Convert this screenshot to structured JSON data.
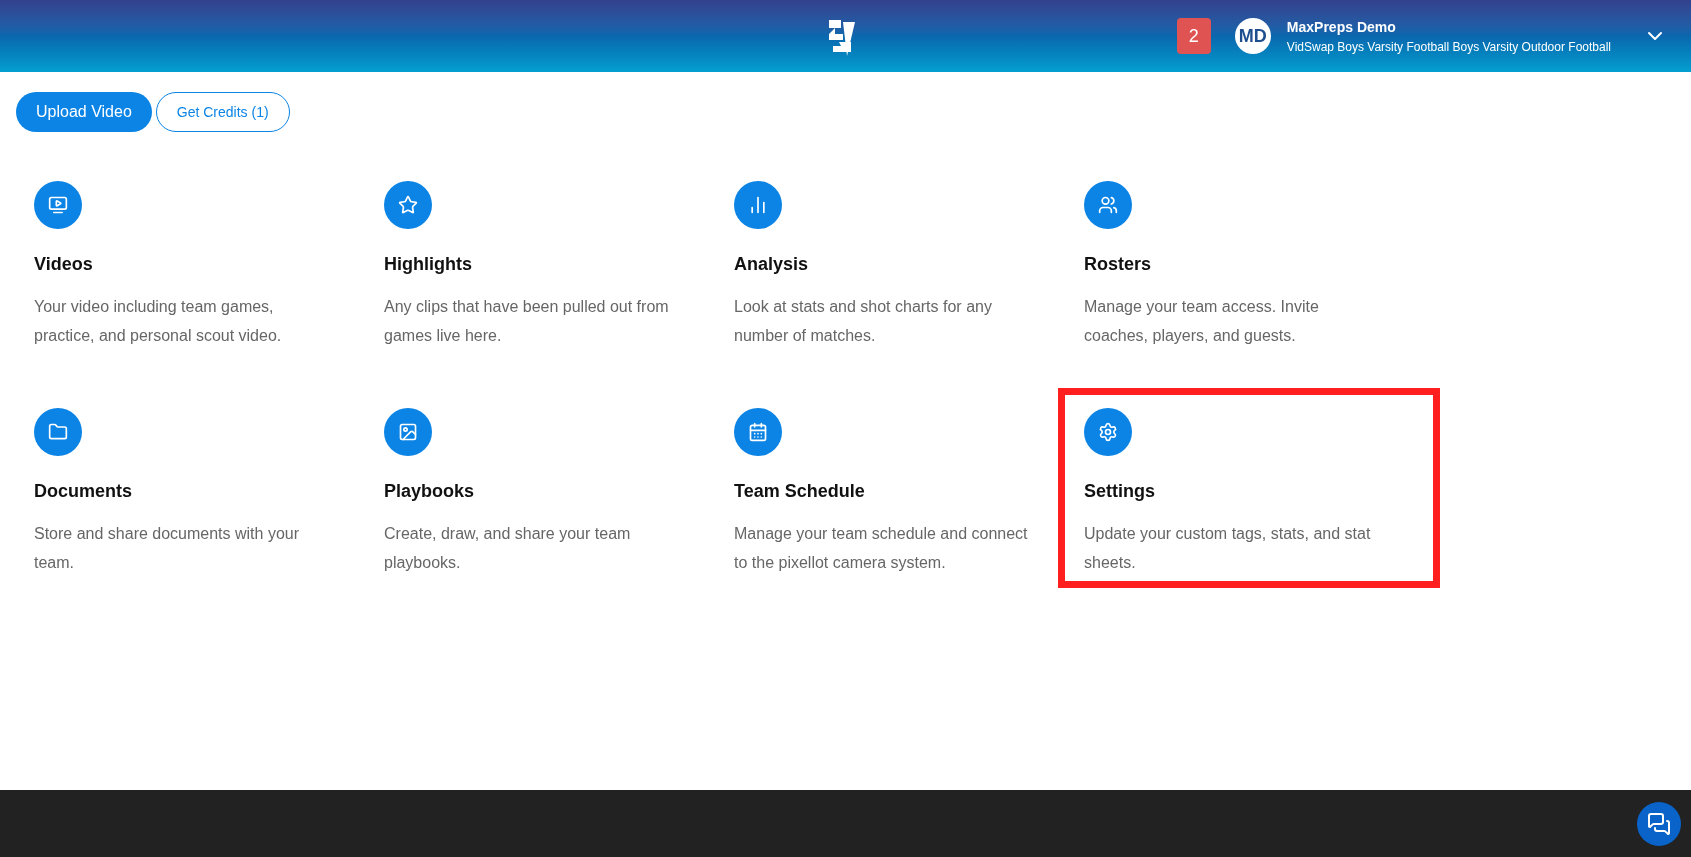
{
  "header": {
    "notification_count": "2",
    "avatar_initials": "MD",
    "user_name": "MaxPreps Demo",
    "team_name": "VidSwap Boys Varsity Football Boys Varsity Outdoor Football"
  },
  "actions": [
    {
      "label": "Upload Video",
      "kind": "primary"
    },
    {
      "label": "Get Credits (1)",
      "kind": "outline"
    }
  ],
  "cards": [
    {
      "title": "Videos",
      "description": "Your video including team games, practice, and personal scout video.",
      "highlighted": false
    },
    {
      "title": "Highlights",
      "description": "Any clips that have been pulled out from games live here.",
      "highlighted": false
    },
    {
      "title": "Analysis",
      "description": "Look at stats and shot charts for any number of matches.",
      "highlighted": false
    },
    {
      "title": "Rosters",
      "description": "Manage your team access. Invite coaches, players, and guests.",
      "highlighted": false
    },
    {
      "title": "Documents",
      "description": "Store and share documents with your team.",
      "highlighted": false
    },
    {
      "title": "Playbooks",
      "description": "Create, draw, and share your team playbooks.",
      "highlighted": false
    },
    {
      "title": "Team Schedule",
      "description": "Manage your team schedule and connect to the pixellot camera system.",
      "highlighted": false
    },
    {
      "title": "Settings",
      "description": "Update your custom tags, stats, and stat sheets.",
      "highlighted": true
    }
  ]
}
